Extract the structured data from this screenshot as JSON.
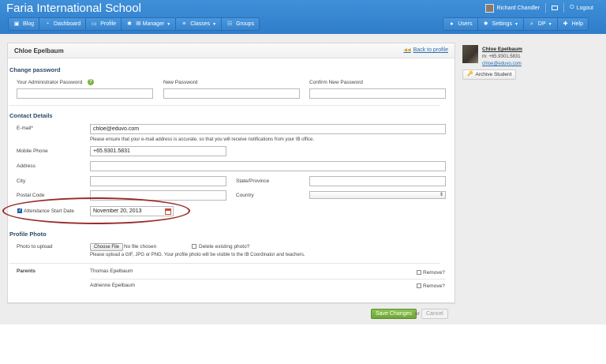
{
  "header": {
    "title": "Faria International School",
    "user_name": "Richard Chandler",
    "logout_label": "Logout"
  },
  "nav": {
    "left": [
      {
        "label": "Blog",
        "icon": "blog-icon",
        "glyph": "▣"
      },
      {
        "label": "Dashboard",
        "icon": "dashboard-icon",
        "glyph": "◔"
      },
      {
        "label": "Profile",
        "icon": "profile-icon",
        "glyph": "▭"
      },
      {
        "label": "IB Manager",
        "icon": "ib-manager-icon",
        "glyph": "✱",
        "dropdown": true
      },
      {
        "label": "Classes",
        "icon": "classes-icon",
        "glyph": "≡",
        "dropdown": true
      },
      {
        "label": "Groups",
        "icon": "groups-icon",
        "glyph": "☷"
      }
    ],
    "right": [
      {
        "label": "Users",
        "icon": "users-icon",
        "glyph": "●"
      },
      {
        "label": "Settings",
        "icon": "settings-icon",
        "glyph": "✹",
        "dropdown": true
      },
      {
        "label": "DP",
        "icon": "search-icon",
        "glyph": "⌕",
        "dropdown": true
      },
      {
        "label": "Help",
        "icon": "help-icon",
        "glyph": "✚"
      }
    ]
  },
  "panel": {
    "title": "Chloe Epelbaum",
    "back_label": "Back to profile"
  },
  "change_password": {
    "heading": "Change password",
    "admin_label": "Your Administrator Password",
    "new_label": "New Password",
    "confirm_label": "Confirm New Password"
  },
  "contact": {
    "heading": "Contact Details",
    "email_label": "E-mail*",
    "email_value": "chloe@eduvo.com",
    "email_hint": "Please ensure that your e-mail address is accurate, so that you will receive notifications from your IB office.",
    "mobile_label": "Mobile Phone",
    "mobile_value": "+65.9301.5831",
    "address_label": "Address",
    "city_label": "City",
    "state_label": "State/Province",
    "postal_label": "Postal Code",
    "country_label": "Country",
    "attendance_label": "Attendance Start Date",
    "attendance_value": "November 20, 2013"
  },
  "photo": {
    "heading": "Profile Photo",
    "upload_label": "Photo to upload",
    "choose_label": "Choose File",
    "no_file": "No file chosen",
    "delete_label": "Delete existing photo?",
    "hint": "Please upload a GIF, JPG or PNG. Your profile photo will be visible to the IB Coordinator and teachers."
  },
  "parents": {
    "label": "Parents",
    "list": [
      {
        "name": "Thomas Epelbaum",
        "remove_label": "Remove?"
      },
      {
        "name": "Adrienne Epelbaum",
        "remove_label": "Remove?"
      }
    ]
  },
  "actions": {
    "save_label": "Save Changes",
    "or_label": "or",
    "cancel_label": "Cancel"
  },
  "profile_card": {
    "name": "Chloe Epelbaum",
    "phone": "m: +65.9301.5831",
    "email": "chloe@eduvo.com",
    "archive_label": "Archive Student"
  }
}
